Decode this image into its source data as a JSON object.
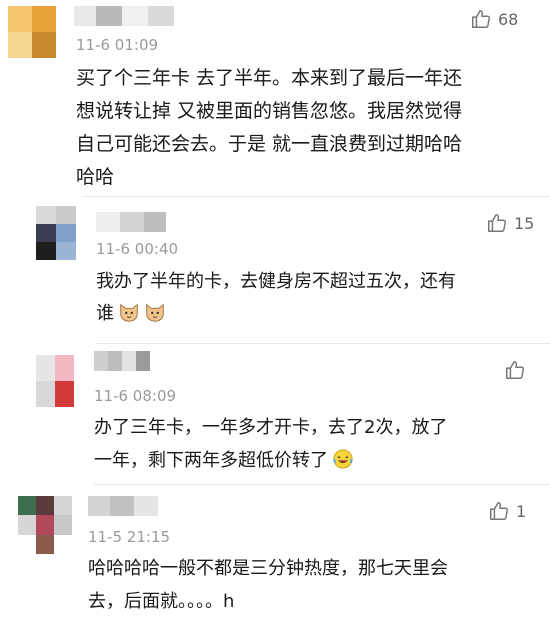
{
  "comments": [
    {
      "name_colors": [
        "#e8e8e8",
        "#b8b8b8",
        "#f0f0f0",
        "#d9d9d9"
      ],
      "avatar_colors": [
        "#f2c56e",
        "#e8a23a",
        "#f6d58e",
        "#c98a2e"
      ],
      "timestamp": "11-6 01:09",
      "text": "买了个三年卡 去了半年。本来到了最后一年还\n想说转让掉 又被里面的销售忽悠。我居然觉得\n自己可能还会去。于是 就一直浪费到过期哈哈\n哈哈",
      "likes": "68"
    },
    {
      "name_colors": [
        "#efefef",
        "#d4d4d4",
        "#bdbdbd"
      ],
      "avatar_colors": [
        "#3b3d52",
        "#7fa0c8",
        "#d9d9d9",
        "#1e1e1e",
        "#9ab4d6",
        "#c9c9c9"
      ],
      "timestamp": "11-6 00:40",
      "text": "我办了半年的卡，去健身房不超过五次，还有\n谁",
      "emojis": [
        "cat-face-icon",
        "cat-face-icon"
      ],
      "likes": "15"
    },
    {
      "name_colors": [
        "#cfcfcf",
        "#bdbdbd",
        "#e2e2e2",
        "#9a9a9a"
      ],
      "avatar_colors": [
        "#e6e6e6",
        "#f4b8c4",
        "#d8d8d8",
        "#d43a3a"
      ],
      "timestamp": "11-6 08:09",
      "text": "办了三年卡，一年多才开卡，去了2次，放了\n一年，剩下两年多超低价转了",
      "emojis": [
        "laughing-tears-icon"
      ],
      "likes": ""
    },
    {
      "name_colors": [
        "#d4d4d4",
        "#c2c2c2",
        "#e6e6e6"
      ],
      "avatar_colors": [
        "#3e6e4e",
        "#b04a5a",
        "#5a3a3a",
        "#d6d6d6",
        "#8a5a4a",
        "#c8c8c8"
      ],
      "timestamp": "11-5 21:15",
      "text": "哈哈哈哈一般不都是三分钟热度，那七天里会\n去，后面就。。。。h",
      "likes": "1"
    }
  ]
}
